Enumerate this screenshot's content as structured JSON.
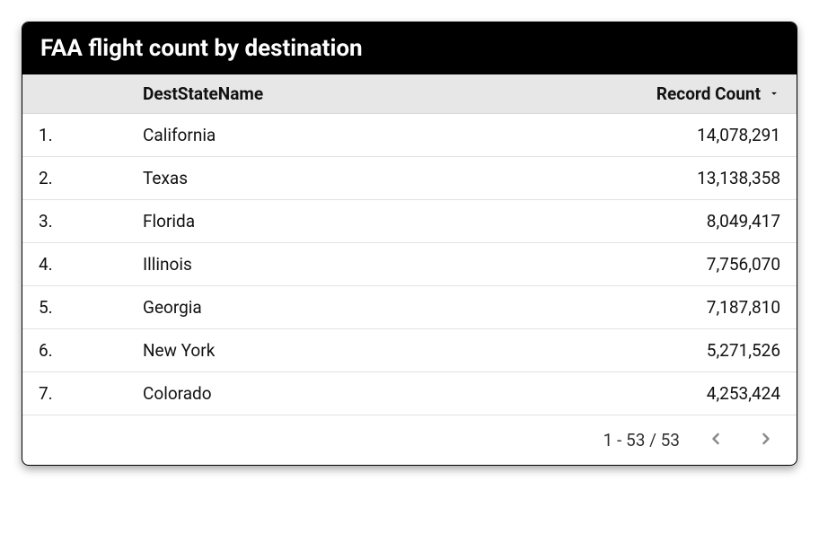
{
  "title": "FAA flight count by destination",
  "headers": {
    "index": "",
    "name": "DestStateName",
    "count": "Record Count"
  },
  "rows": [
    {
      "index": "1.",
      "name": "California",
      "count": "14,078,291"
    },
    {
      "index": "2.",
      "name": "Texas",
      "count": "13,138,358"
    },
    {
      "index": "3.",
      "name": "Florida",
      "count": "8,049,417"
    },
    {
      "index": "4.",
      "name": "Illinois",
      "count": "7,756,070"
    },
    {
      "index": "5.",
      "name": "Georgia",
      "count": "7,187,810"
    },
    {
      "index": "6.",
      "name": "New York",
      "count": "5,271,526"
    },
    {
      "index": "7.",
      "name": "Colorado",
      "count": "4,253,424"
    }
  ],
  "footer": {
    "range": "1 - 53 / 53"
  },
  "chart_data": {
    "type": "table",
    "title": "FAA flight count by destination",
    "columns": [
      "DestStateName",
      "Record Count"
    ],
    "sort": {
      "column": "Record Count",
      "direction": "desc"
    },
    "total_rows": 53,
    "visible_range": "1 - 53 / 53",
    "data": [
      {
        "DestStateName": "California",
        "Record Count": 14078291
      },
      {
        "DestStateName": "Texas",
        "Record Count": 13138358
      },
      {
        "DestStateName": "Florida",
        "Record Count": 8049417
      },
      {
        "DestStateName": "Illinois",
        "Record Count": 7756070
      },
      {
        "DestStateName": "Georgia",
        "Record Count": 7187810
      },
      {
        "DestStateName": "New York",
        "Record Count": 5271526
      },
      {
        "DestStateName": "Colorado",
        "Record Count": 4253424
      }
    ]
  }
}
